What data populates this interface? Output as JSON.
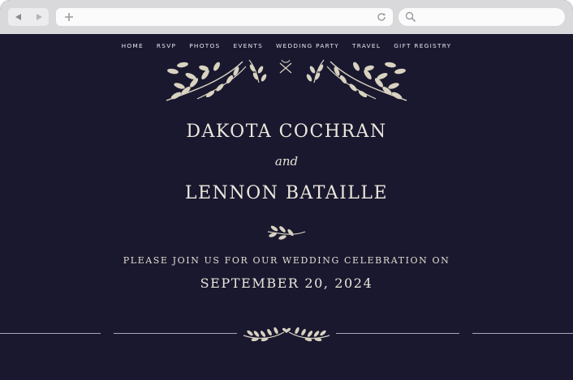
{
  "browser": {
    "back_icon": "triangle-left",
    "forward_icon": "triangle-right",
    "new_tab_icon": "plus",
    "reload_icon": "circular-arrow",
    "search_icon": "magnifier"
  },
  "nav": {
    "items": [
      {
        "label": "HOME"
      },
      {
        "label": "RSVP"
      },
      {
        "label": "PHOTOS"
      },
      {
        "label": "EVENTS"
      },
      {
        "label": "WEDDING PARTY"
      },
      {
        "label": "TRAVEL"
      },
      {
        "label": "GIFT REGISTRY"
      }
    ]
  },
  "hero": {
    "name1": "DAKOTA COCHRAN",
    "conjunction": "and",
    "name2": "LENNON BATAILLE",
    "invitation": "PLEASE JOIN US FOR OUR WEDDING CELEBRATION ON",
    "date": "SEPTEMBER 20, 2024"
  },
  "colors": {
    "background": "#19182f",
    "text": "#ece7dc",
    "botanical": "#d8d2c0"
  }
}
